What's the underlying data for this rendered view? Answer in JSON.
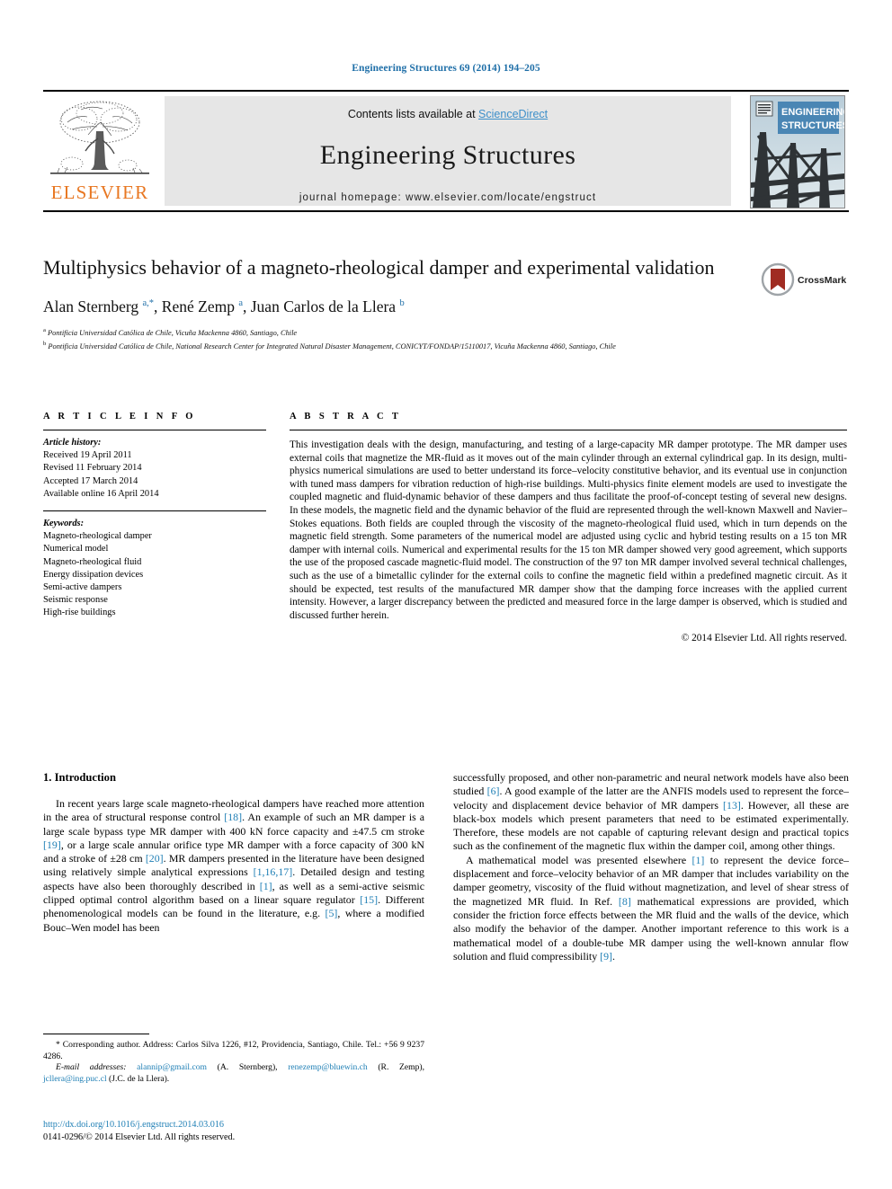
{
  "running_head": "Engineering Structures 69 (2014) 194–205",
  "masthead": {
    "contents_prefix": "Contents lists available at ",
    "sciencedirect": "ScienceDirect",
    "journal_title": "Engineering Structures",
    "homepage": "journal homepage: www.elsevier.com/locate/engstruct",
    "publisher_name": "ELSEVIER",
    "cover_title_line1": "ENGINEERING",
    "cover_title_line2": "STRUCTURES",
    "accent_orange": "#E87722",
    "accent_blue": "#3d8fc9",
    "band_gray": "#e6e6e6"
  },
  "crossmark": {
    "label": "CrossMark"
  },
  "article": {
    "title": "Multiphysics behavior of a magneto-rheological damper and experimental validation",
    "authors_html": "Alan Sternberg <sup>a,*</sup>, René Zemp <sup>a</sup>, Juan Carlos de la Llera <sup>b</sup>",
    "affiliation_a": "Pontificia Universidad Católica de Chile, Vicuña Mackenna 4860, Santiago, Chile",
    "affiliation_b": "Pontificia Universidad Católica de Chile, National Research Center for Integrated Natural Disaster Management, CONICYT/FONDAP/15110017, Vicuña Mackenna 4860, Santiago, Chile"
  },
  "info": {
    "heading": "A R T I C L E    I N F O",
    "history_label": "Article history:",
    "history": [
      "Received 19 April 2011",
      "Revised 11 February 2014",
      "Accepted 17 March 2014",
      "Available online 16 April 2014"
    ],
    "keywords_label": "Keywords:",
    "keywords": [
      "Magneto-rheological damper",
      "Numerical model",
      "Magneto-rheological fluid",
      "Energy dissipation devices",
      "Semi-active dampers",
      "Seismic response",
      "High-rise buildings"
    ]
  },
  "abstract": {
    "heading": "A B S T R A C T",
    "text": "This investigation deals with the design, manufacturing, and testing of a large-capacity MR damper prototype. The MR damper uses external coils that magnetize the MR-fluid as it moves out of the main cylinder through an external cylindrical gap. In its design, multi-physics numerical simulations are used to better understand its force–velocity constitutive behavior, and its eventual use in conjunction with tuned mass dampers for vibration reduction of high-rise buildings. Multi-physics finite element models are used to investigate the coupled magnetic and fluid-dynamic behavior of these dampers and thus facilitate the proof-of-concept testing of several new designs. In these models, the magnetic field and the dynamic behavior of the fluid are represented through the well-known Maxwell and Navier–Stokes equations. Both fields are coupled through the viscosity of the magneto-rheological fluid used, which in turn depends on the magnetic field strength. Some parameters of the numerical model are adjusted using cyclic and hybrid testing results on a 15 ton MR damper with internal coils. Numerical and experimental results for the 15 ton MR damper showed very good agreement, which supports the use of the proposed cascade magnetic-fluid model. The construction of the 97 ton MR damper involved several technical challenges, such as the use of a bimetallic cylinder for the external coils to confine the magnetic field within a predefined magnetic circuit. As it should be expected, test results of the manufactured MR damper show that the damping force increases with the applied current intensity. However, a larger discrepancy between the predicted and measured force in the large damper is observed, which is studied and discussed further herein.",
    "copyright": "© 2014 Elsevier Ltd. All rights reserved."
  },
  "body": {
    "section_heading": "1. Introduction",
    "left_p1_html": "In recent years large scale magneto-rheological dampers have reached more attention in the area of structural response control <span class=\"ref\">[18]</span>. An example of such an MR damper is a large scale bypass type MR damper with 400 kN force capacity and ±47.5 cm stroke <span class=\"ref\">[19]</span>, or a large scale annular orifice type MR damper with a force capacity of 300 kN and a stroke of ±28 cm <span class=\"ref\">[20]</span>. MR dampers presented in the literature have been designed using relatively simple analytical expressions <span class=\"ref\">[1,16,17]</span>. Detailed design and testing aspects have also been thoroughly described in <span class=\"ref\">[1]</span>, as well as a semi-active seismic clipped optimal control algorithm based on a linear square regulator <span class=\"ref\">[15]</span>. Different phenomenological models can be found in the literature, e.g. <span class=\"ref\">[5]</span>, where a modified Bouc–Wen model has been",
    "right_p1_html": "successfully proposed, and other non-parametric and neural network models have also been studied <span class=\"ref\">[6]</span>. A good example of the latter are the ANFIS models used to represent the force–velocity and displacement device behavior of MR dampers <span class=\"ref\">[13]</span>. However, all these are black-box models which present parameters that need to be estimated experimentally. Therefore, these models are not capable of capturing relevant design and practical topics such as the confinement of the magnetic flux within the damper coil, among other things.",
    "right_p2_html": "A mathematical model was presented elsewhere <span class=\"ref\">[1]</span> to represent the device force–displacement and force–velocity behavior of an MR damper that includes variability on the damper geometry, viscosity of the fluid without magnetization, and level of shear stress of the magnetized MR fluid. In Ref. <span class=\"ref\">[8]</span> mathematical expressions are provided, which consider the friction force effects between the MR fluid and the walls of the device, which also modify the behavior of the damper. Another important reference to this work is a mathematical model of a double-tube MR damper using the well-known annular flow solution and fluid compressibility <span class=\"ref\">[9]</span>."
  },
  "footnote": {
    "corresponding_html": "* Corresponding author. Address: Carlos Silva 1226, #12, Providencia, Santiago, Chile. Tel.: +56 9 9237 4286.",
    "emails_html": "<span class=\"fn-em\">E-mail addresses:</span> <span class=\"link\">alannip@gmail.com</span> (A. Sternberg), <span class=\"link\">renezemp@bluewin.ch</span> (R. Zemp), <span class=\"link\">jcllera@ing.puc.cl</span> (J.C. de la Llera)."
  },
  "doi": {
    "url": "http://dx.doi.org/10.1016/j.engstruct.2014.03.016",
    "issn_line": "0141-0296/© 2014 Elsevier Ltd. All rights reserved."
  }
}
